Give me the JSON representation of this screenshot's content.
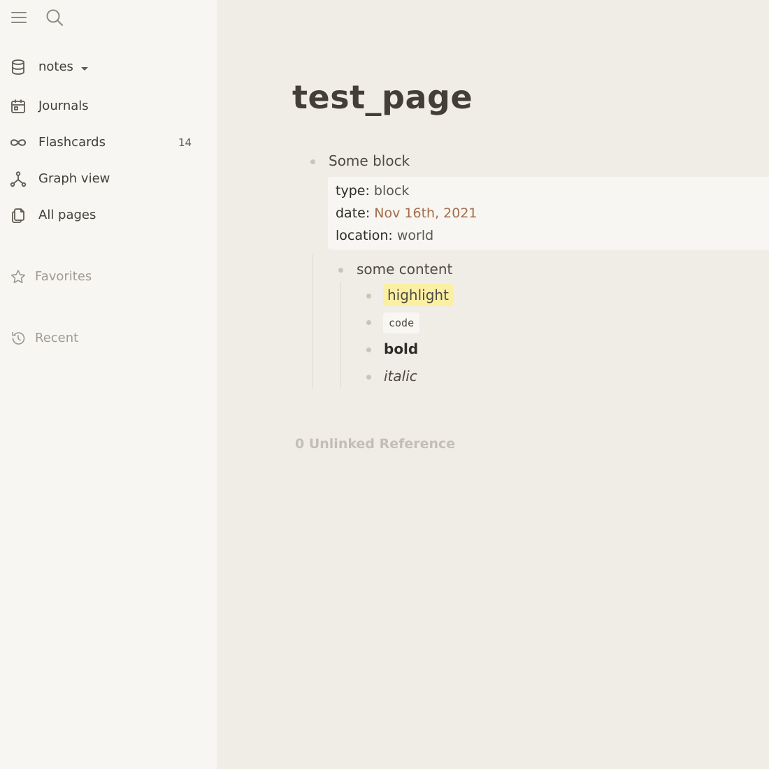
{
  "sidebar": {
    "menu_icon": "hamburger-menu-icon",
    "search_icon": "search-icon",
    "graph_selector": {
      "icon": "database-icon",
      "label": "notes",
      "dropdown_icon": "caret-down-icon"
    },
    "nav": [
      {
        "icon": "calendar-icon",
        "label": "Journals"
      },
      {
        "icon": "infinity-icon",
        "label": "Flashcards",
        "count": "14"
      },
      {
        "icon": "graph-icon",
        "label": "Graph view"
      },
      {
        "icon": "pages-icon",
        "label": "All pages"
      }
    ],
    "favorites": {
      "icon": "star-icon",
      "label": "Favorites"
    },
    "recent": {
      "icon": "history-icon",
      "label": "Recent"
    }
  },
  "page": {
    "title": "test_page",
    "block": {
      "text": "Some block",
      "properties": [
        {
          "key": "type",
          "sep": ":",
          "value": "block"
        },
        {
          "key": "date",
          "sep": ":",
          "value": "Nov 16th, 2021"
        },
        {
          "key": "location",
          "sep": ":",
          "value": "world"
        }
      ],
      "child": {
        "text": "some content",
        "children": [
          {
            "style": "highlight",
            "text": "highlight"
          },
          {
            "style": "code",
            "text": "code"
          },
          {
            "style": "bold",
            "text": "bold"
          },
          {
            "style": "italic",
            "text": "italic"
          }
        ]
      }
    },
    "unlinked_references": "0 Unlinked Reference"
  },
  "colors": {
    "sidebar_bg": "#f7f6f3",
    "main_bg": "#f0ede6",
    "date_link": "#a46c49",
    "highlight_bg": "#fbefa4"
  }
}
